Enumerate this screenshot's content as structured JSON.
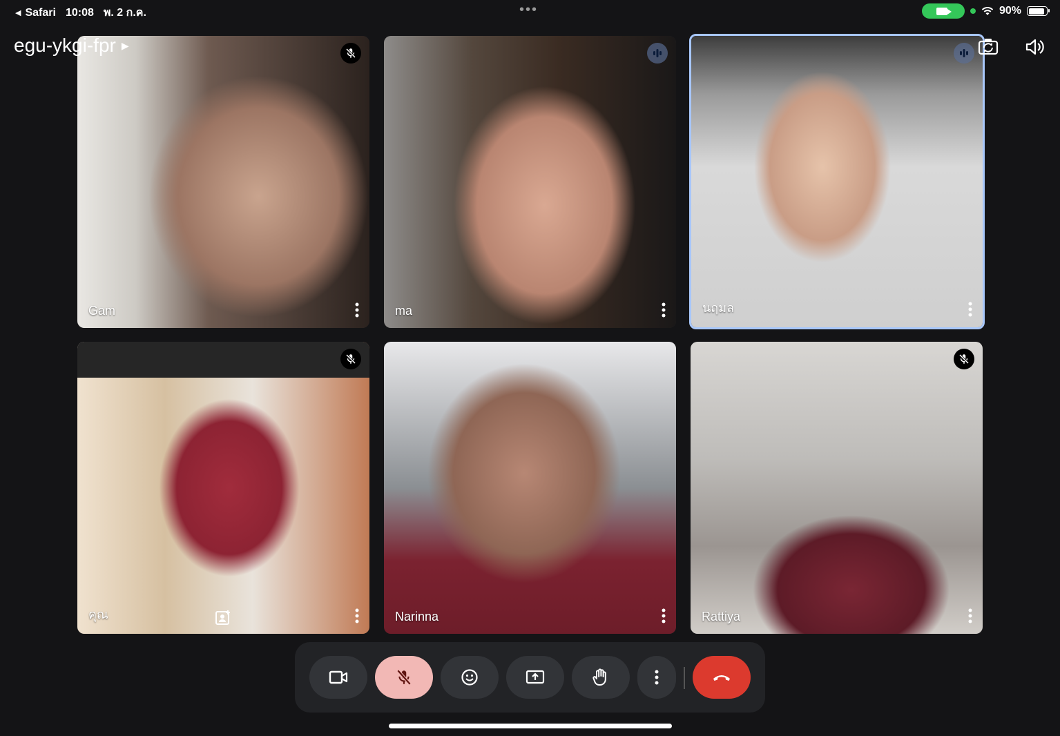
{
  "status_bar": {
    "back_app": "Safari",
    "time": "10:08",
    "date": "พ. 2 ก.ค.",
    "battery": "90%"
  },
  "meeting": {
    "code": "egu-ykgi-fpr"
  },
  "participants": [
    {
      "name": "Gam",
      "mic": "muted",
      "speaking": false
    },
    {
      "name": "ma",
      "mic": "talking",
      "speaking": false
    },
    {
      "name": "นฤมล",
      "mic": "talking",
      "speaking": true
    },
    {
      "name": "คุณ",
      "mic": "muted",
      "speaking": false
    },
    {
      "name": "Narinna",
      "mic": "on",
      "speaking": false
    },
    {
      "name": "Rattiya",
      "mic": "muted",
      "speaking": false
    }
  ],
  "controls": [
    {
      "id": "camera",
      "icon": "video-camera-icon"
    },
    {
      "id": "microphone",
      "icon": "mic-off-icon",
      "state": "muted"
    },
    {
      "id": "reactions",
      "icon": "emoji-icon"
    },
    {
      "id": "present",
      "icon": "present-screen-icon"
    },
    {
      "id": "raise-hand",
      "icon": "hand-icon"
    },
    {
      "id": "more",
      "icon": "more-vert-icon"
    },
    {
      "id": "leave",
      "icon": "phone-hangup-icon"
    }
  ],
  "colors": {
    "speaking_border": "#a8c7fa",
    "mic_muted_bg": "#f2b8b5",
    "end_call": "#dc3a2e",
    "battery_cam_pill": "#34c759"
  }
}
